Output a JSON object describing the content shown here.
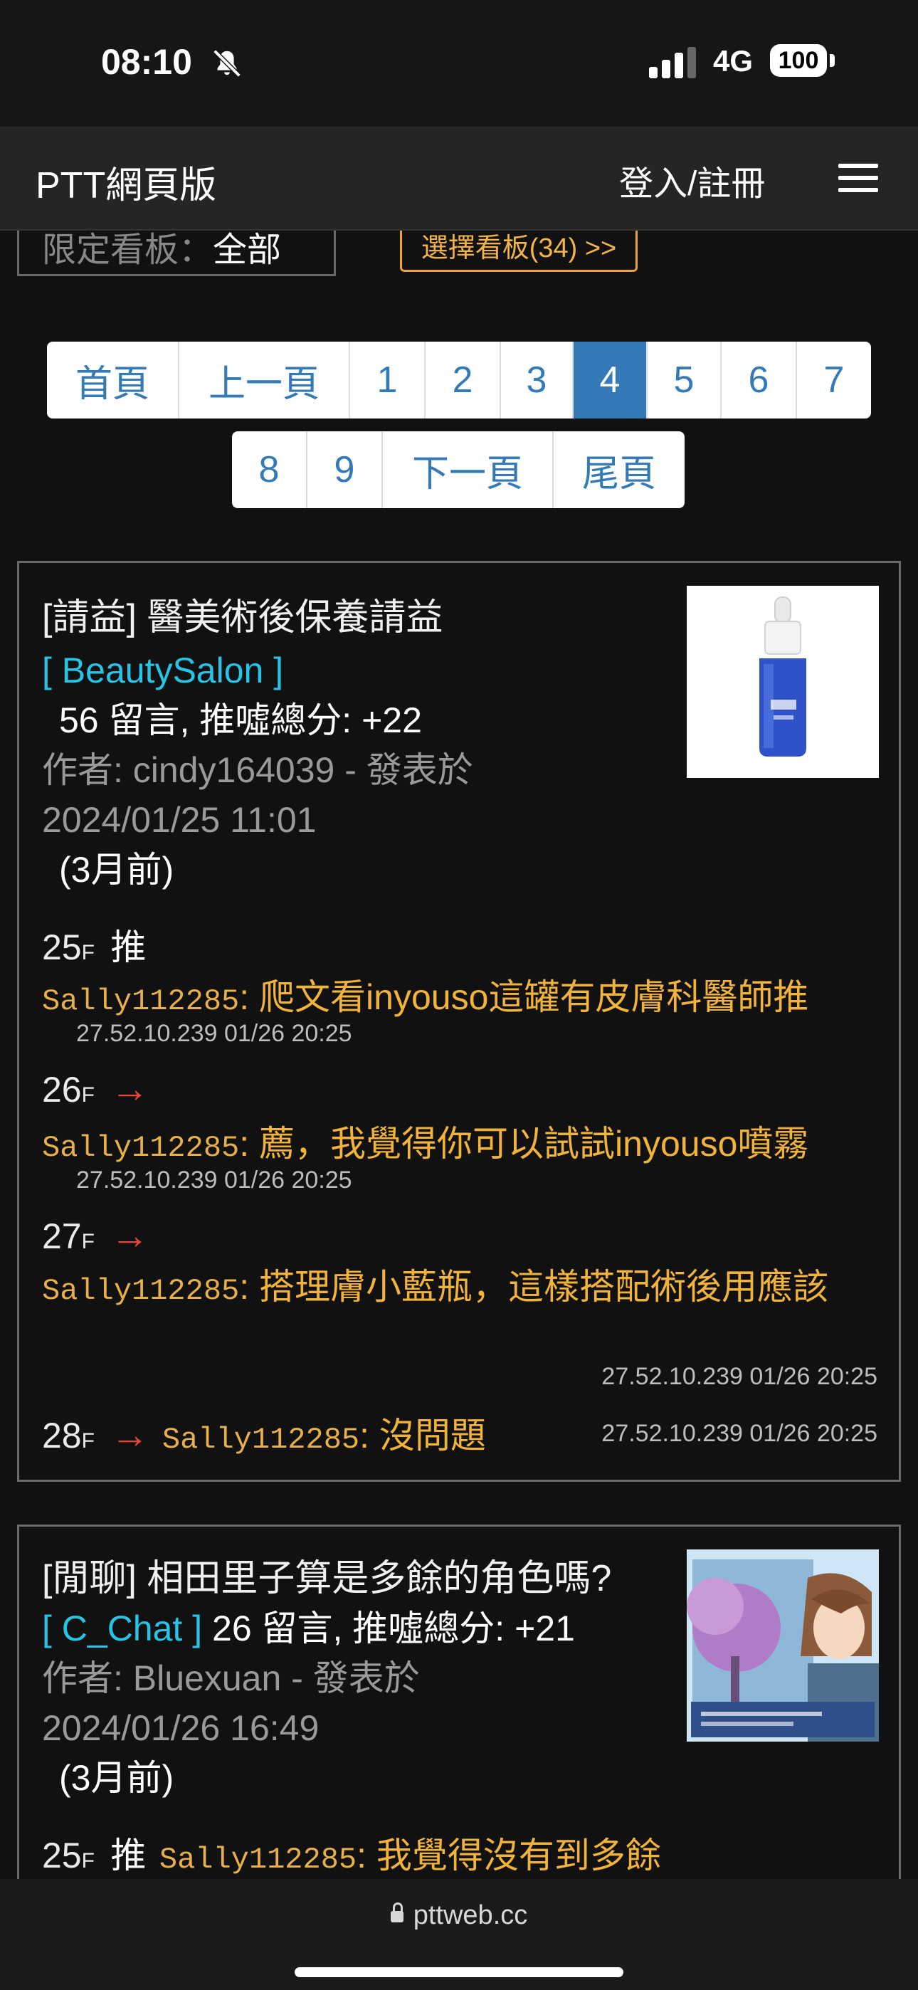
{
  "status_bar": {
    "time": "08:10",
    "network": "4G",
    "battery": "100"
  },
  "navbar": {
    "brand": "PTT網頁版",
    "login": "登入/註冊"
  },
  "filter": {
    "label": "限定看板：",
    "value": "全部",
    "choose_board": "選擇看板(34) >>"
  },
  "pagination": {
    "row1": [
      "首頁",
      "上一頁",
      "1",
      "2",
      "3",
      "4",
      "5",
      "6",
      "7"
    ],
    "row2": [
      "8",
      "9",
      "下一頁",
      "尾頁"
    ],
    "active": "4"
  },
  "posts": [
    {
      "title": "[請益] 醫美術後保養請益",
      "board": "[ BeautySalon ]",
      "comments_label": "56 留言, 推噓總分: +22",
      "author_line": "作者: cindy164039 - 發表於",
      "date": "2024/01/25 11:01",
      "age": "(3月前)",
      "thumbnail": "serum-bottle-image",
      "pushes": [
        {
          "floor": "25",
          "floor_suffix": "F",
          "tag": "推",
          "user": "Sally112285",
          "content": ": 爬文看inyouso這罐有皮膚科醫師推",
          "ip_time": "27.52.10.239 01/26 20:25"
        },
        {
          "floor": "26",
          "floor_suffix": "F",
          "tag": "→",
          "user": "Sally112285",
          "content": ": 薦，我覺得你可以試試inyouso噴霧",
          "ip_time": "27.52.10.239 01/26 20:25"
        },
        {
          "floor": "27",
          "floor_suffix": "F",
          "tag": "→",
          "user": "Sally112285",
          "content": ": 搭理膚小藍瓶，這樣搭配術後用應該",
          "ip_time": "27.52.10.239 01/26 20:25"
        },
        {
          "floor": "28",
          "floor_suffix": "F",
          "tag": "→",
          "user": "Sally112285",
          "content": ": 沒問題",
          "ip_time": "27.52.10.239 01/26 20:25"
        }
      ]
    },
    {
      "title": "[閒聊] 相田里子算是多餘的角色嗎?",
      "board": "[ C_Chat ]",
      "comments_label": "26 留言, 推噓總分: +21",
      "author_line": "作者: Bluexuan - 發表於",
      "date": "2024/01/26 16:49",
      "age": "(3月前)",
      "thumbnail": "anime-character-image",
      "pushes": [
        {
          "floor": "25",
          "floor_suffix": "F",
          "tag": "推",
          "user": "Sally112285",
          "content": ": 我覺得沒有到多餘"
        }
      ]
    }
  ],
  "browser": {
    "url": "pttweb.cc"
  }
}
